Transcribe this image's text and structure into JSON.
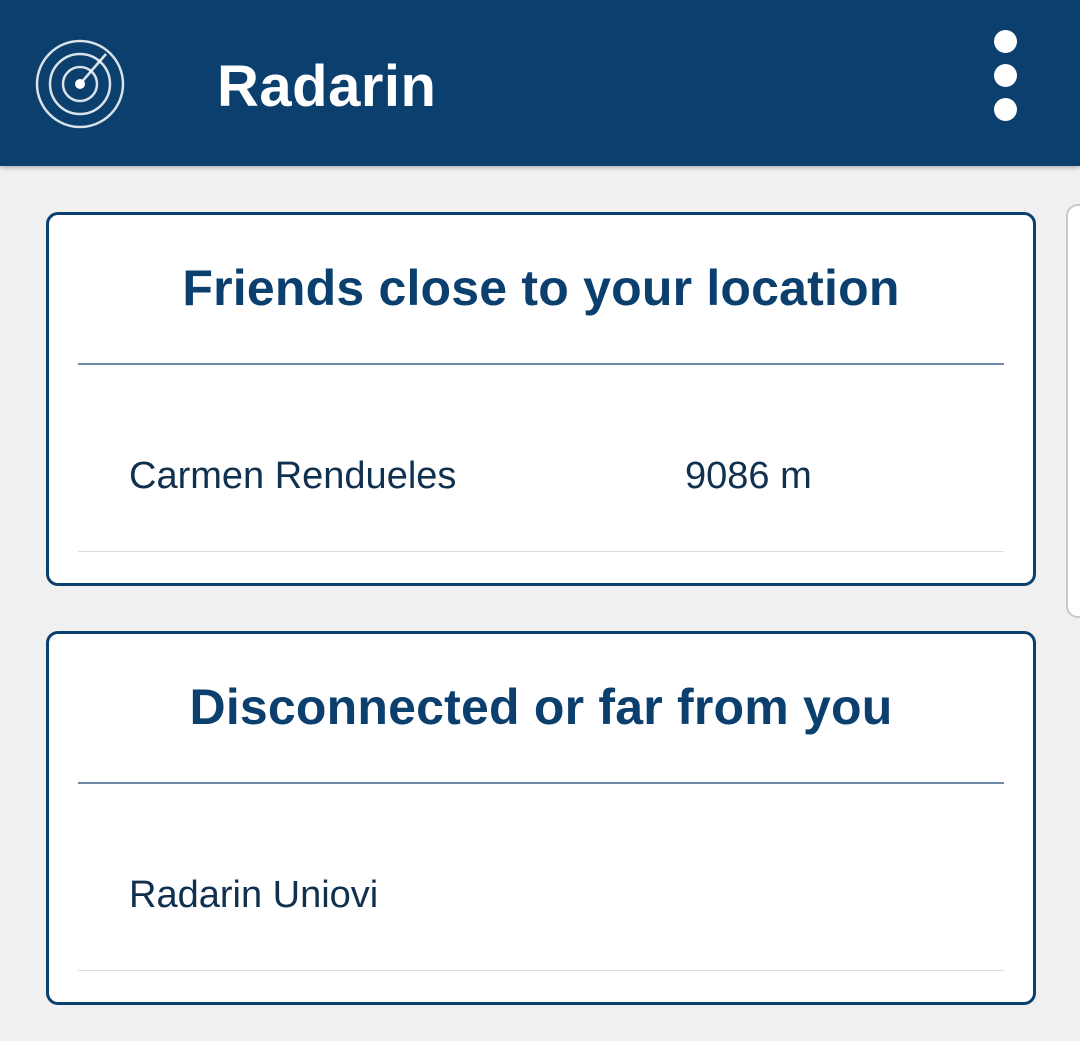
{
  "appbar": {
    "title": "Radarin",
    "logo_icon": "radar-icon",
    "menu_icon": "more-vert-icon",
    "background_color": "#0b3f6e"
  },
  "sections": [
    {
      "title": "Friends close to your location",
      "friends": [
        {
          "name": "Carmen Rendueles",
          "distance": "9086 m"
        }
      ]
    },
    {
      "title": "Disconnected or far from you",
      "friends": [
        {
          "name": "Radarin Uniovi",
          "distance": ""
        }
      ]
    }
  ],
  "colors": {
    "primary": "#0b3f6e",
    "background": "#f0f0f0",
    "card": "#ffffff"
  }
}
